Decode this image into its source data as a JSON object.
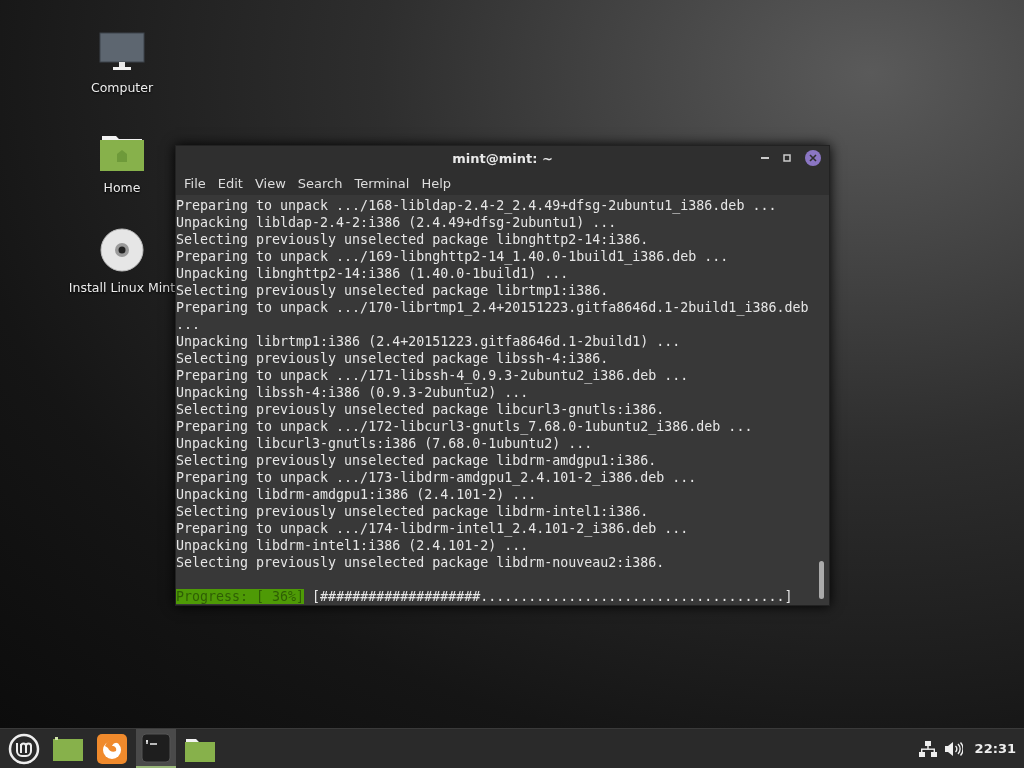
{
  "desktop_icons": [
    {
      "kind": "computer",
      "label": "Computer"
    },
    {
      "kind": "home",
      "label": "Home"
    },
    {
      "kind": "disc",
      "label": "Install Linux Mint"
    }
  ],
  "window": {
    "title": "mint@mint: ~",
    "menu": [
      "File",
      "Edit",
      "View",
      "Search",
      "Terminal",
      "Help"
    ],
    "lines": [
      "Preparing to unpack .../168-libldap-2.4-2_2.4.49+dfsg-2ubuntu1_i386.deb ...",
      "Unpacking libldap-2.4-2:i386 (2.4.49+dfsg-2ubuntu1) ...",
      "Selecting previously unselected package libnghttp2-14:i386.",
      "Preparing to unpack .../169-libnghttp2-14_1.40.0-1build1_i386.deb ...",
      "Unpacking libnghttp2-14:i386 (1.40.0-1build1) ...",
      "Selecting previously unselected package librtmp1:i386.",
      "Preparing to unpack .../170-librtmp1_2.4+20151223.gitfa8646d.1-2build1_i386.deb",
      "...",
      "Unpacking librtmp1:i386 (2.4+20151223.gitfa8646d.1-2build1) ...",
      "Selecting previously unselected package libssh-4:i386.",
      "Preparing to unpack .../171-libssh-4_0.9.3-2ubuntu2_i386.deb ...",
      "Unpacking libssh-4:i386 (0.9.3-2ubuntu2) ...",
      "Selecting previously unselected package libcurl3-gnutls:i386.",
      "Preparing to unpack .../172-libcurl3-gnutls_7.68.0-1ubuntu2_i386.deb ...",
      "Unpacking libcurl3-gnutls:i386 (7.68.0-1ubuntu2) ...",
      "Selecting previously unselected package libdrm-amdgpu1:i386.",
      "Preparing to unpack .../173-libdrm-amdgpu1_2.4.101-2_i386.deb ...",
      "Unpacking libdrm-amdgpu1:i386 (2.4.101-2) ...",
      "Selecting previously unselected package libdrm-intel1:i386.",
      "Preparing to unpack .../174-libdrm-intel1_2.4.101-2_i386.deb ...",
      "Unpacking libdrm-intel1:i386 (2.4.101-2) ...",
      "Selecting previously unselected package libdrm-nouveau2:i386."
    ],
    "progress_label": "Progress: [ 36%]",
    "progress_bar": "[####################......................................]"
  },
  "taskbar": {
    "launchers": [
      {
        "kind": "menu",
        "active": false
      },
      {
        "kind": "desktop",
        "active": false
      },
      {
        "kind": "browser",
        "active": false
      },
      {
        "kind": "terminal",
        "active": true
      },
      {
        "kind": "files",
        "active": false
      }
    ],
    "clock": "22:31"
  }
}
